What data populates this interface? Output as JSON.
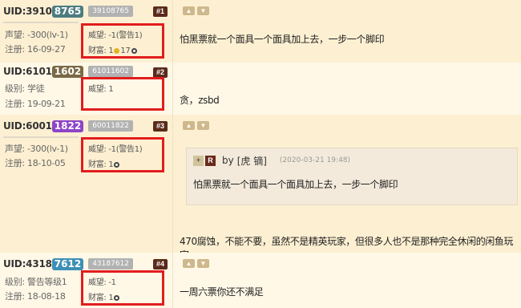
{
  "posts": [
    {
      "uid_prefix": "UID:3910",
      "uid_suffix": "8765",
      "uid_full": "39108765",
      "floor": "#1",
      "line1_label": "声望: -300(lv-1)",
      "line2_label": "注册: 16-09-27",
      "prestige": "威望: -1(警告1)",
      "wealth_label": "财富: 1",
      "wealth_gold_count": "17",
      "content": "怕黑票就一个面具一个面具加上去，一步一个脚印"
    },
    {
      "uid_prefix": "UID:6101",
      "uid_suffix": "1602",
      "uid_full": "61011602",
      "floor": "#2",
      "line1_label": "级别: 学徒",
      "line2_label": "注册: 19-09-21",
      "prestige": "威望: 1",
      "content": "贪，zsbd"
    },
    {
      "uid_prefix": "UID:6001",
      "uid_suffix": "1822",
      "uid_full": "60011822",
      "floor": "#3",
      "line1_label": "声望: -300(lv-1)",
      "line2_label": "注册: 18-10-05",
      "prestige": "威望: -1(警告1)",
      "wealth_label": "财富: 1",
      "quote": {
        "by": "by",
        "name_icon": "虎",
        "name": "[虎 镝]",
        "date": "(2020-03-21 19:48)",
        "text": "怕黑票就一个面具一个面具加上去，一步一个脚印"
      },
      "content": "470腐蚀，不能不要，虽然不是精英玩家，但很多人也不是那种完全休闲的闲鱼玩家。"
    },
    {
      "uid_prefix": "UID:4318",
      "uid_suffix": "7612",
      "uid_full": "43187612",
      "floor": "#4",
      "line1_label": "级别: 警告等级1",
      "line2_label": "注册: 18-08-18",
      "prestige": "威望: -1",
      "wealth_label": "财富: 1",
      "content": "一周六票你还不满足"
    }
  ],
  "icons": {
    "thumb_up": "thumb-up-icon",
    "thumb_down": "thumb-down-icon",
    "quote_plus": "+",
    "quote_r": "R"
  },
  "colors": {
    "highlight_border": "#e21d1d",
    "floor_badge": "#5a2a1a",
    "uid_badge_1": "#4d7c80",
    "uid_badge_2": "#7a6a45",
    "uid_badge_3": "#8e44c8",
    "uid_badge_4": "#3d8fb5"
  }
}
